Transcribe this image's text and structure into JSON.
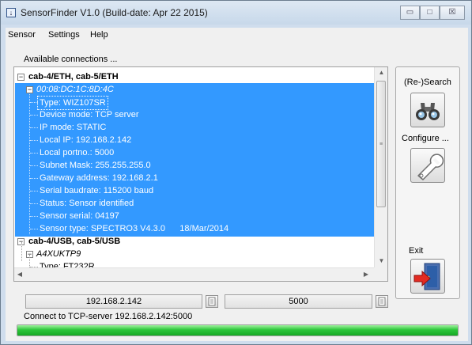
{
  "window": {
    "title": "SensorFinder V1.0 (Build-date: Apr 22 2015)",
    "controls": {
      "minimize": "▭",
      "maximize": "□",
      "close": "☒"
    }
  },
  "menu": {
    "items": [
      "Sensor",
      "Settings",
      "Help"
    ]
  },
  "connections_label": "Available connections ...",
  "tree": {
    "group1": "cab-4/ETH, cab-5/ETH",
    "device1": "00:08:DC:1C:8D:4C",
    "props": [
      "Type: WIZ107SR",
      "Device mode: TCP server",
      "IP mode: STATIC",
      "Local IP: 192.168.2.142",
      "Local portno.: 5000",
      "Subnet Mask: 255.255.255.0",
      "Gateway address: 192.168.2.1",
      "Serial baudrate: 115200 baud",
      "Status: Sensor identified",
      "Sensor serial: 04197",
      "Sensor type: SPECTRO3 V4.3.0      18/Mar/2014"
    ],
    "group2": "cab-4/USB, cab-5/USB",
    "device2": "A4XUKTP9",
    "device2_props": [
      "Type: FT232R"
    ]
  },
  "side": {
    "search_label": "(Re-)Search",
    "configure_label": "Configure ...",
    "exit_label": "Exit"
  },
  "fields": {
    "ip": "192.168.2.142",
    "port": "5000"
  },
  "status_text": "Connect to TCP-server 192.168.2.142:5000",
  "progress": 1.0,
  "colors": {
    "selection": "#3399ff",
    "progress": "#16a824"
  }
}
